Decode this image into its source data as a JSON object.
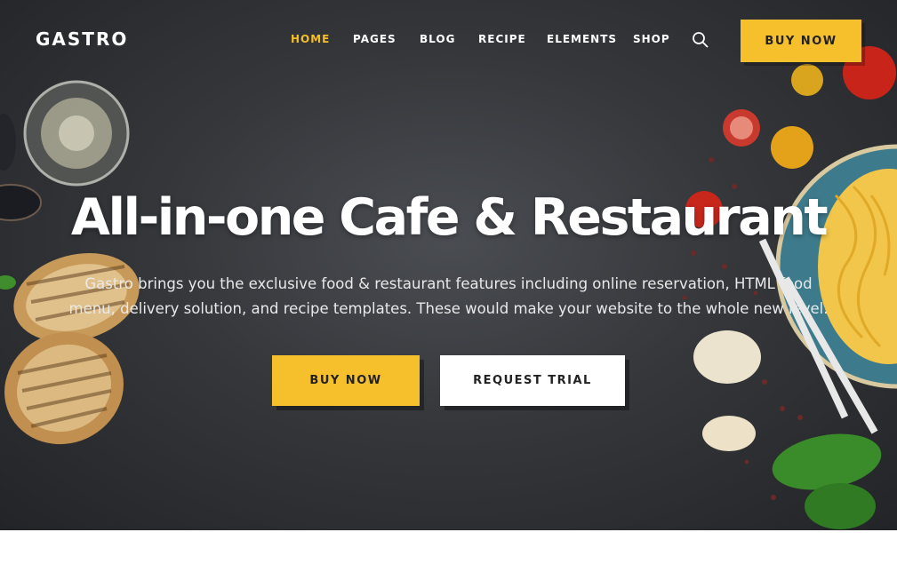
{
  "brand": {
    "logo": "GASTRO"
  },
  "nav": {
    "items": [
      {
        "label": "HOME",
        "active": true
      },
      {
        "label": "PAGES",
        "active": false
      },
      {
        "label": "BLOG",
        "active": false
      },
      {
        "label": "RECIPE",
        "active": false
      },
      {
        "label": "ELEMENTS",
        "active": false
      },
      {
        "label": "SHOP",
        "active": false
      }
    ],
    "search_icon": "search-icon",
    "cta_label": "BUY NOW"
  },
  "hero": {
    "headline": "All-in-one Cafe & Restaurant",
    "subtext_line1": "Gastro brings you the exclusive food & restaurant features including online reservation, HTML food",
    "subtext_line2": "menu, delivery solution, and recipe templates. These would make your website to the whole new level.",
    "primary_button": "BUY NOW",
    "secondary_button": "REQUEST TRIAL"
  },
  "colors": {
    "accent": "#f6c02d",
    "hero_background": "#3a3c40",
    "text_light": "#ffffff"
  }
}
